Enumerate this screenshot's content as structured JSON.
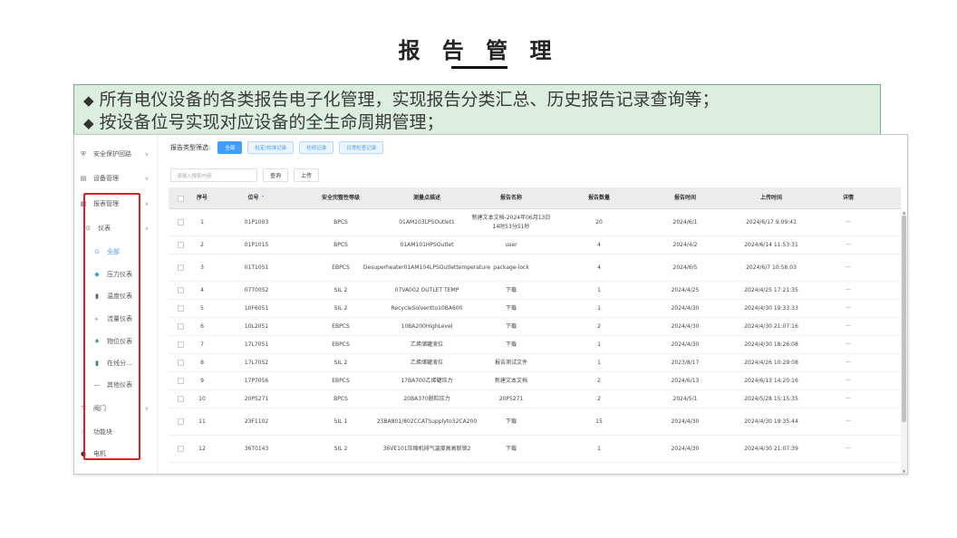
{
  "slide": {
    "title": "报 告 管 理",
    "notes": [
      "所有电仪设备的各类报告电子化管理，实现报告分类汇总、历史报告记录查询等；",
      "按设备位号实现对应设备的全生命周期管理；"
    ],
    "bullet": "◆"
  },
  "sidebar": {
    "items": [
      {
        "label": "安全保护回路",
        "icon": "shield-icon",
        "glyph": "⛨",
        "chevron": "∨"
      },
      {
        "label": "设备管理",
        "icon": "device-icon",
        "glyph": "▤",
        "chevron": "∨"
      },
      {
        "label": "报表管理",
        "icon": "report-icon",
        "glyph": "▦",
        "chevron": "∧"
      },
      {
        "label": "仪表",
        "icon": "gauge-icon",
        "glyph": "⊙",
        "chevron": "∧"
      },
      {
        "label": "全部",
        "icon": "all-icon",
        "glyph": "⊙"
      },
      {
        "label": "压力仪表",
        "icon": "pressure-icon",
        "glyph": "◆"
      },
      {
        "label": "温度仪表",
        "icon": "thermometer-icon",
        "glyph": "▮"
      },
      {
        "label": "流量仪表",
        "icon": "flow-icon",
        "glyph": "▸"
      },
      {
        "label": "物位仪表",
        "icon": "level-icon",
        "glyph": "♦"
      },
      {
        "label": "在线分...",
        "icon": "analyzer-icon",
        "glyph": "▮"
      },
      {
        "label": "其他仪表",
        "icon": "other-icon",
        "glyph": "—"
      },
      {
        "label": "阀门",
        "icon": "valve-icon",
        "glyph": "⊤",
        "chevron": "∨"
      },
      {
        "label": "功能块",
        "icon": "function-block-icon",
        "glyph": "⊙"
      },
      {
        "label": "电机",
        "icon": "motor-icon",
        "glyph": "◐"
      }
    ]
  },
  "filter": {
    "label": "报告类型筛选:",
    "chips": [
      "全部",
      "检定/校准记录",
      "检修记录",
      "日常检查记录"
    ]
  },
  "search": {
    "placeholder": "请输入搜索内容",
    "query_label": "查询",
    "upload_label": "上传"
  },
  "table": {
    "headers": {
      "index": "序号",
      "tag": "位号",
      "sort_arrow": "⌃",
      "sil": "安全完整性等级",
      "point": "测量点描述",
      "name": "报告名称",
      "count": "报告数量",
      "time": "报告时间",
      "upload": "上传时间",
      "detail": "详情"
    },
    "rows": [
      {
        "index": "1",
        "tag": "01P1003",
        "sil": "BPCS",
        "point": "01AM103LPSOutlet1",
        "name": "新建文本文档-2024年06月13日14时53分51秒",
        "count": "20",
        "time": "2024/6/1",
        "upload": "2024/6/17 9:09:41",
        "detail": "···"
      },
      {
        "index": "2",
        "tag": "01P1015",
        "sil": "BPCS",
        "point": "01AM101HPSOutlet",
        "name": "user",
        "count": "4",
        "time": "2024/4/2",
        "upload": "2024/6/14 11:53:31",
        "detail": "···"
      },
      {
        "index": "3",
        "tag": "01T1051",
        "sil": "EBPCS",
        "point": "Desuperheater01AM104LPSOutlettemperature",
        "name": "package-lock",
        "count": "4",
        "time": "2024/6/5",
        "upload": "2024/6/7 10:58:03",
        "detail": "···"
      },
      {
        "index": "4",
        "tag": "07T0052",
        "sil": "SIL 2",
        "point": "07VA002 OUTLET TEMP",
        "name": "下载",
        "count": "1",
        "time": "2024/4/25",
        "upload": "2024/4/25 17:21:35",
        "detail": "···"
      },
      {
        "index": "5",
        "tag": "10F6051",
        "sil": "SIL 2",
        "point": "RecycleSolventto10BA600",
        "name": "下载",
        "count": "1",
        "time": "2024/4/30",
        "upload": "2024/4/30 19:33:33",
        "detail": "···"
      },
      {
        "index": "6",
        "tag": "10L2051",
        "sil": "EBPCS",
        "point": "10BA200HighLevel",
        "name": "下载",
        "count": "2",
        "time": "2024/4/30",
        "upload": "2024/4/30 21:07:16",
        "detail": "···"
      },
      {
        "index": "7",
        "tag": "17L7051",
        "sil": "EBPCS",
        "point": "乙烯储罐液位",
        "name": "下载",
        "count": "1",
        "time": "2024/4/30",
        "upload": "2024/4/30 18:26:08",
        "detail": "···"
      },
      {
        "index": "8",
        "tag": "17L7052",
        "sil": "SIL 2",
        "point": "乙烯储罐液位",
        "name": "报告测试文件",
        "count": "1",
        "time": "2023/8/17",
        "upload": "2024/4/26 10:29:08",
        "detail": "···"
      },
      {
        "index": "9",
        "tag": "17P7056",
        "sil": "EBPCS",
        "point": "17BA700乙烯罐压力",
        "name": "新建文本文档",
        "count": "2",
        "time": "2024/6/13",
        "upload": "2024/6/13 14:20:16",
        "detail": "···"
      },
      {
        "index": "10",
        "tag": "20P5271",
        "sil": "BPCS",
        "point": "20BA370脱粒压力",
        "name": "20P5271",
        "count": "2",
        "time": "2024/5/1",
        "upload": "2024/5/28 15:15:35",
        "detail": "···"
      },
      {
        "index": "11",
        "tag": "23F1102",
        "sil": "SIL 1",
        "point": "23BA801/802CCATSupplyto32CA200",
        "name": "下载",
        "count": "15",
        "time": "2024/4/30",
        "upload": "2024/4/30 19:35:44",
        "detail": "···"
      },
      {
        "index": "12",
        "tag": "36T0143",
        "sil": "SIL 2",
        "point": "36VE101压缩机排气温度高高联锁2",
        "name": "下载",
        "count": "1",
        "time": "2024/4/30",
        "upload": "2024/4/30 21:07:39",
        "detail": "···"
      }
    ]
  },
  "scroll": {
    "up": "▲",
    "down": "▼"
  },
  "colors": {
    "accent": "#409eff",
    "highlight": "#e02020",
    "note_bg": "#dbeee0"
  }
}
